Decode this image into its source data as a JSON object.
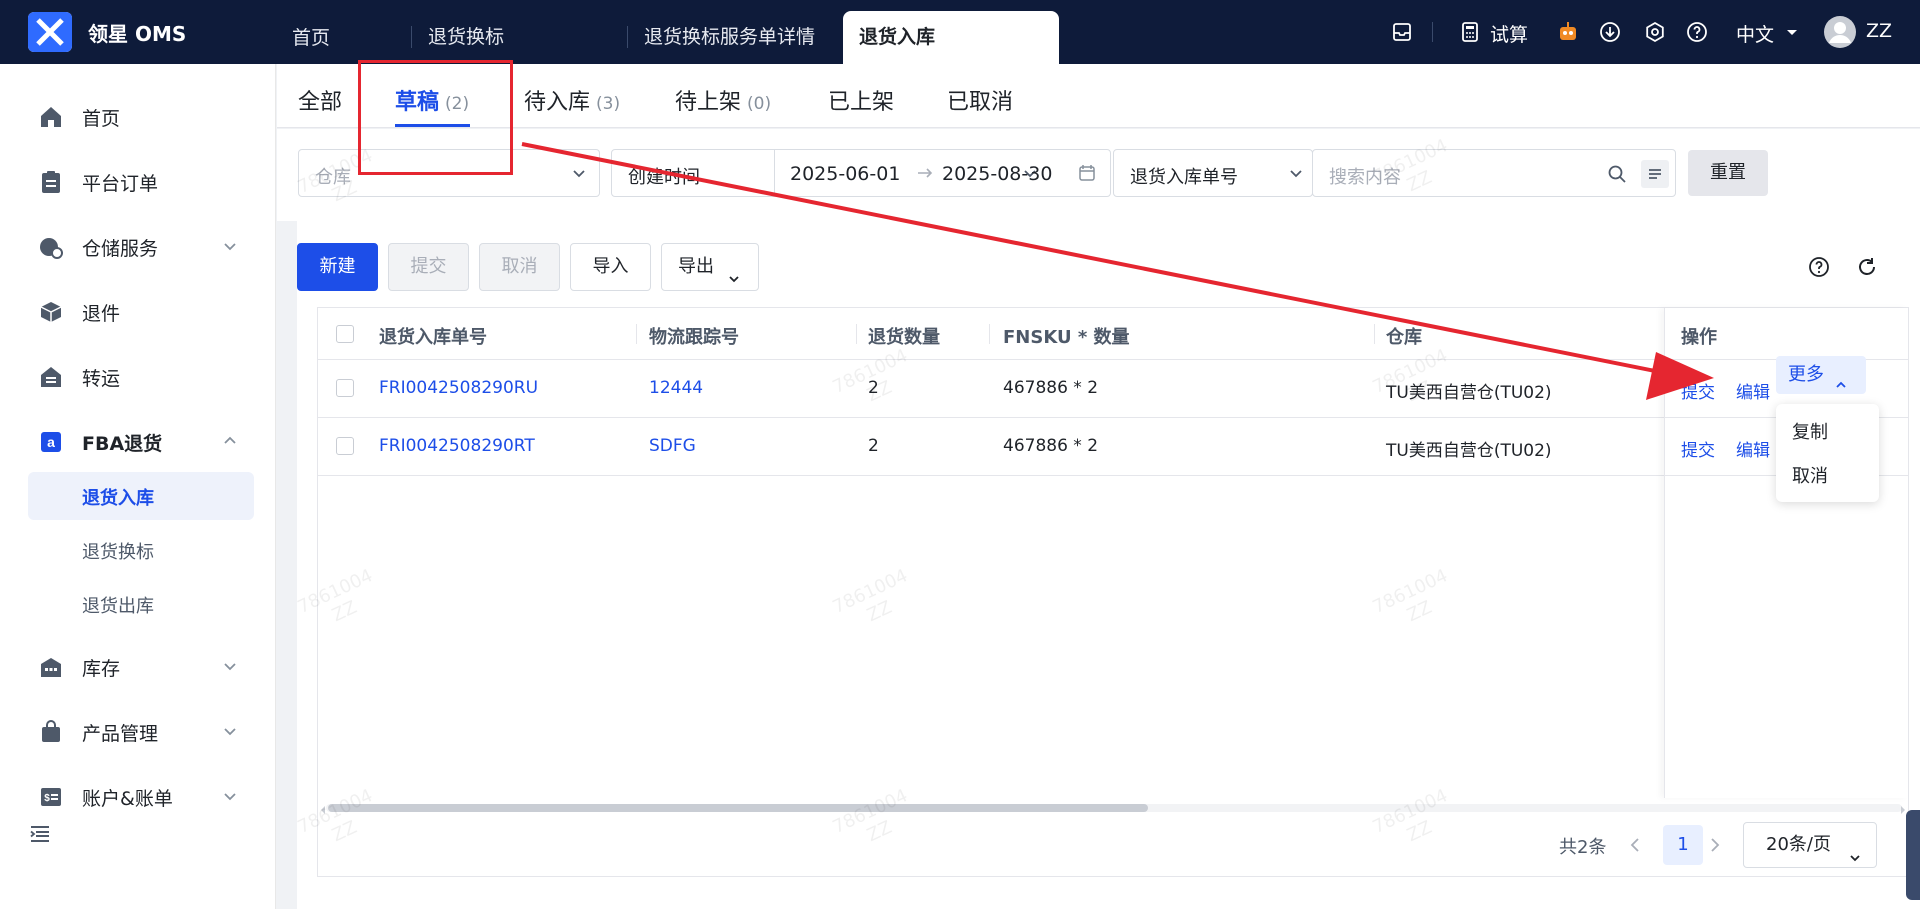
{
  "topbar": {
    "brand": "领星 OMS",
    "tabs": [
      "首页",
      "退货换标",
      "退货换标服务单详情",
      "退货入库"
    ],
    "calc_label": "试算",
    "language": "中文",
    "user": "ZZ"
  },
  "sidebar": {
    "items": [
      {
        "label": "首页",
        "icon": "home-icon"
      },
      {
        "label": "平台订单",
        "icon": "clipboard-icon"
      },
      {
        "label": "仓储服务",
        "icon": "warehouse-service-icon"
      },
      {
        "label": "退件",
        "icon": "return-package-icon"
      },
      {
        "label": "转运",
        "icon": "transfer-icon"
      },
      {
        "label": "FBA退货",
        "icon": "amazon-icon"
      },
      {
        "label": "库存",
        "icon": "inventory-icon"
      },
      {
        "label": "产品管理",
        "icon": "bag-icon"
      },
      {
        "label": "账户&账单",
        "icon": "bill-icon"
      }
    ],
    "subitems": [
      "退货入库",
      "退货换标",
      "退货出库"
    ]
  },
  "status_tabs": [
    {
      "label": "全部",
      "count": ""
    },
    {
      "label": "草稿",
      "count": "(2)"
    },
    {
      "label": "待入库",
      "count": "(3)"
    },
    {
      "label": "待上架",
      "count": "(0)"
    },
    {
      "label": "已上架",
      "count": ""
    },
    {
      "label": "已取消",
      "count": ""
    }
  ],
  "filters": {
    "warehouse_placeholder": "仓库",
    "date_type": "创建时间",
    "date_start": "2025-06-01",
    "date_end": "2025-08-30",
    "search_field": "退货入库单号",
    "search_placeholder": "搜索内容",
    "reset_label": "重置"
  },
  "actions": {
    "new": "新建",
    "submit": "提交",
    "cancel": "取消",
    "import": "导入",
    "export": "导出"
  },
  "table": {
    "headers": [
      "退货入库单号",
      "物流跟踪号",
      "退货数量",
      "FNSKU * 数量",
      "仓库",
      "操作"
    ],
    "rows": [
      {
        "order_no": "FRI0042508290RU",
        "tracking": "12444",
        "qty": "2",
        "fnsku": "467886 * 2",
        "warehouse": "TU美西自营仓(TU02)",
        "op_submit": "提交",
        "op_edit": "编辑",
        "op_more": "更多"
      },
      {
        "order_no": "FRI0042508290RT",
        "tracking": "SDFG",
        "qty": "2",
        "fnsku": "467886 * 2",
        "warehouse": "TU美西自营仓(TU02)",
        "op_submit": "提交",
        "op_edit": "编辑"
      }
    ],
    "dropdown": [
      "复制",
      "取消"
    ]
  },
  "pagination": {
    "total": "共2条",
    "current": "1",
    "page_size": "20条/页"
  },
  "watermark": {
    "line1": "7861004",
    "line2": "ZZ"
  },
  "colors": {
    "primary": "#1d4ee8",
    "topbar": "#0e1b3a",
    "annotation": "#e52630"
  }
}
